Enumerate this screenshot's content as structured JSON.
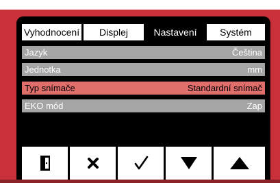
{
  "tabs": [
    {
      "label": "Vyhodnocení",
      "active": false
    },
    {
      "label": "Displej",
      "active": false
    },
    {
      "label": "Nastavení",
      "active": true
    },
    {
      "label": "Systém",
      "active": false
    }
  ],
  "settings": [
    {
      "label": "Jazyk",
      "value": "Čeština",
      "selected": false
    },
    {
      "label": "Jednotka",
      "value": "mm",
      "selected": false
    },
    {
      "label": "Typ snímače",
      "value": "Standardní snímač",
      "selected": true
    },
    {
      "label": "EKO mód",
      "value": "Zap",
      "selected": false
    }
  ],
  "buttons": [
    {
      "icon": "exit-door-icon"
    },
    {
      "icon": "cancel-x-icon"
    },
    {
      "icon": "confirm-check-icon"
    },
    {
      "icon": "arrow-down-icon"
    },
    {
      "icon": "arrow-up-icon"
    }
  ],
  "colors": {
    "device_frame": "#c8303a",
    "screen_bg": "#000000",
    "row_bg": "#a5a5a5",
    "row_selected_bg": "#e06e6a",
    "tab_bg": "#ffffff"
  }
}
